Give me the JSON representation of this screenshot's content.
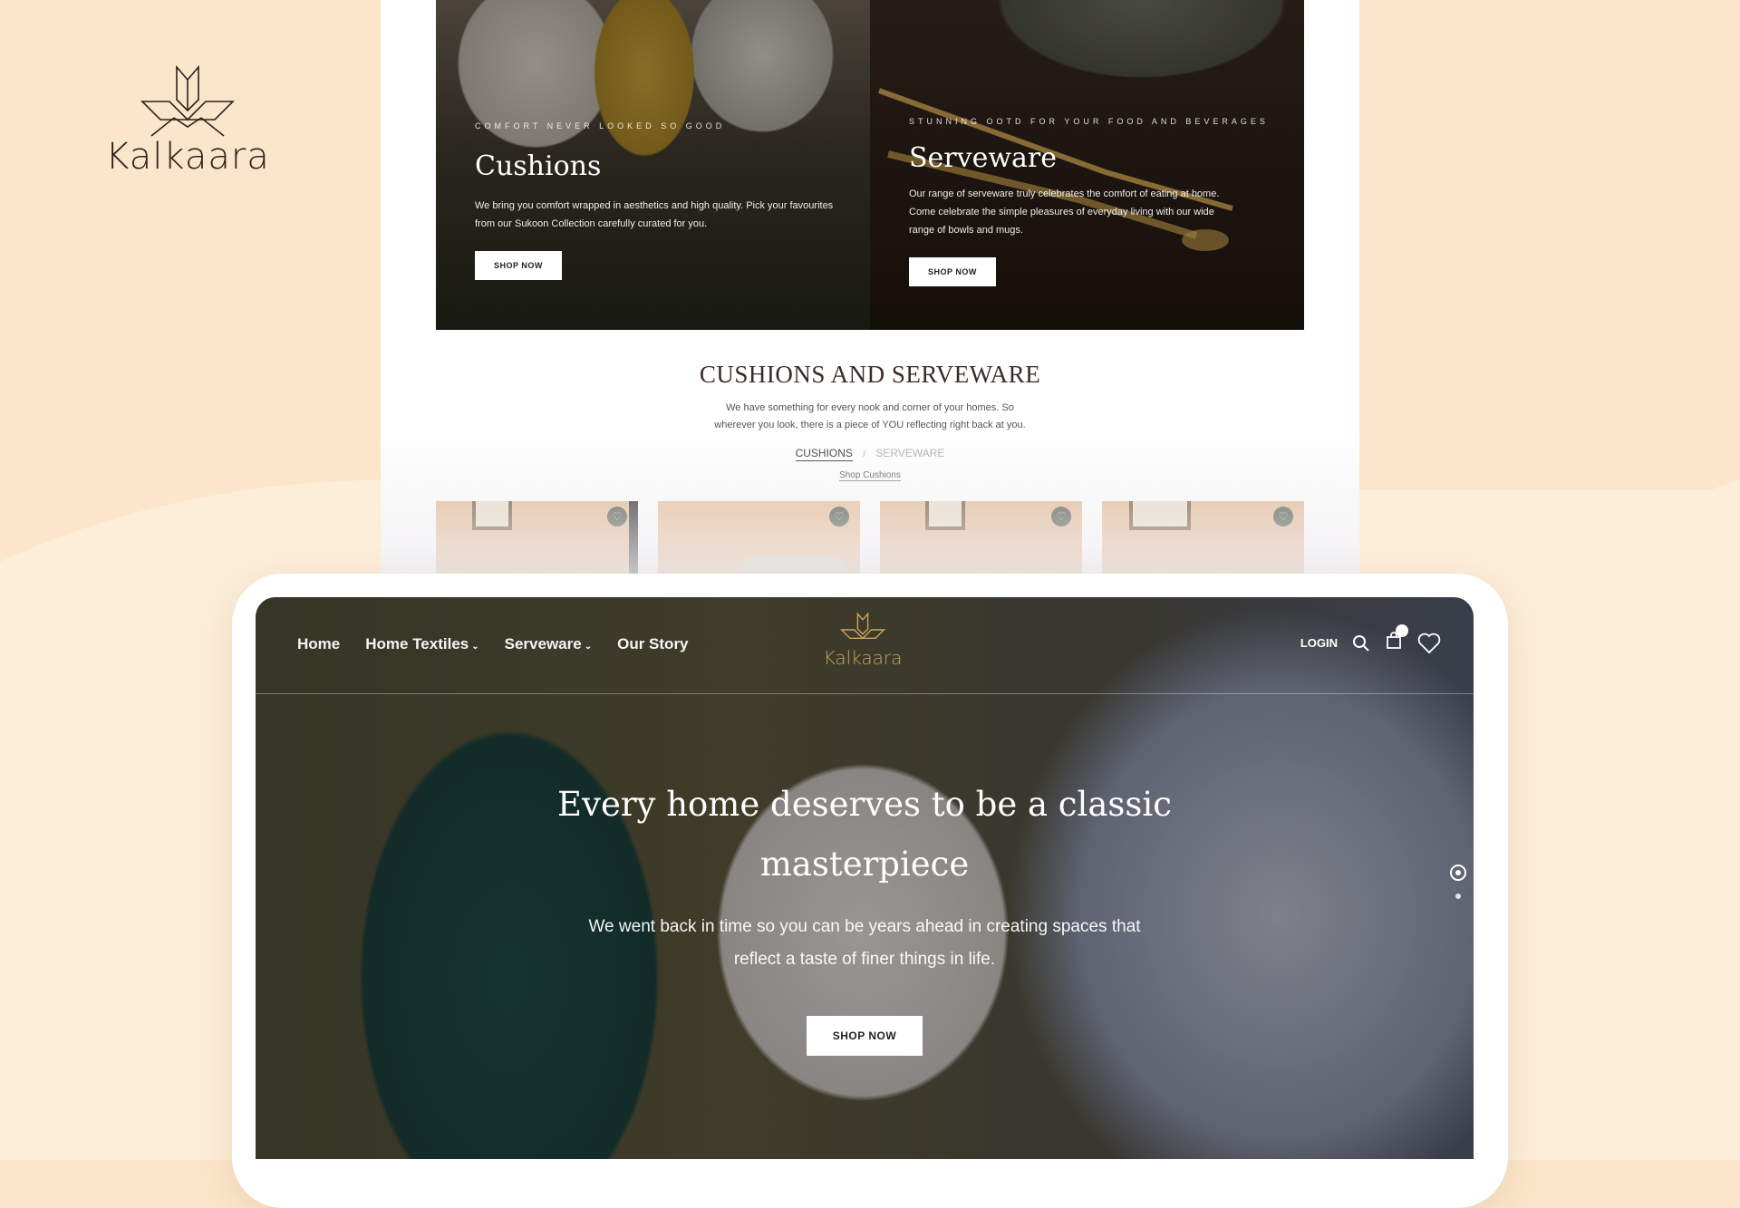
{
  "brand": {
    "name": "Kalkaara"
  },
  "colors": {
    "background": "#fbe6cb",
    "brand_dark": "#2c211c",
    "accent_gold": "#c9a45e"
  },
  "desktop": {
    "banners": [
      {
        "kicker": "COMFORT NEVER LOOKED SO GOOD",
        "title": "Cushions",
        "description": "We bring you comfort wrapped in aesthetics and high quality. Pick your favourites from our Sukoon Collection carefully curated for you.",
        "button": "SHOP NOW"
      },
      {
        "kicker": "STUNNING OOTD FOR YOUR FOOD AND BEVERAGES",
        "title": "Serveware",
        "description": "Our range of serveware truly celebrates the comfort of eating at home. Come celebrate the simple pleasures of everyday living with our wide range of bowls and mugs.",
        "button": "SHOP NOW"
      }
    ],
    "section": {
      "title": "CUSHIONS AND SERVEWARE",
      "description": "We have something for every nook and corner of your homes. So wherever you look, there is a piece of YOU reflecting right back at you.",
      "tabs": [
        "CUSHIONS",
        "SERVEWARE"
      ],
      "tab_separator": "/",
      "shop_link": "Shop Cushions"
    },
    "products": [
      {
        "icon": "heart-icon"
      },
      {
        "icon": "heart-icon"
      },
      {
        "icon": "heart-icon"
      },
      {
        "icon": "heart-icon"
      }
    ]
  },
  "tablet": {
    "nav": {
      "links": [
        "Home",
        "Home Textiles",
        "Serveware",
        "Our Story"
      ],
      "logo": "Kalkaara",
      "login": "LOGIN"
    },
    "hero": {
      "title": "Every home deserves to be a classic masterpiece",
      "subtitle": "We went back in time so you can be years ahead in creating spaces that reflect a taste of finer things in life.",
      "button": "SHOP NOW"
    }
  }
}
